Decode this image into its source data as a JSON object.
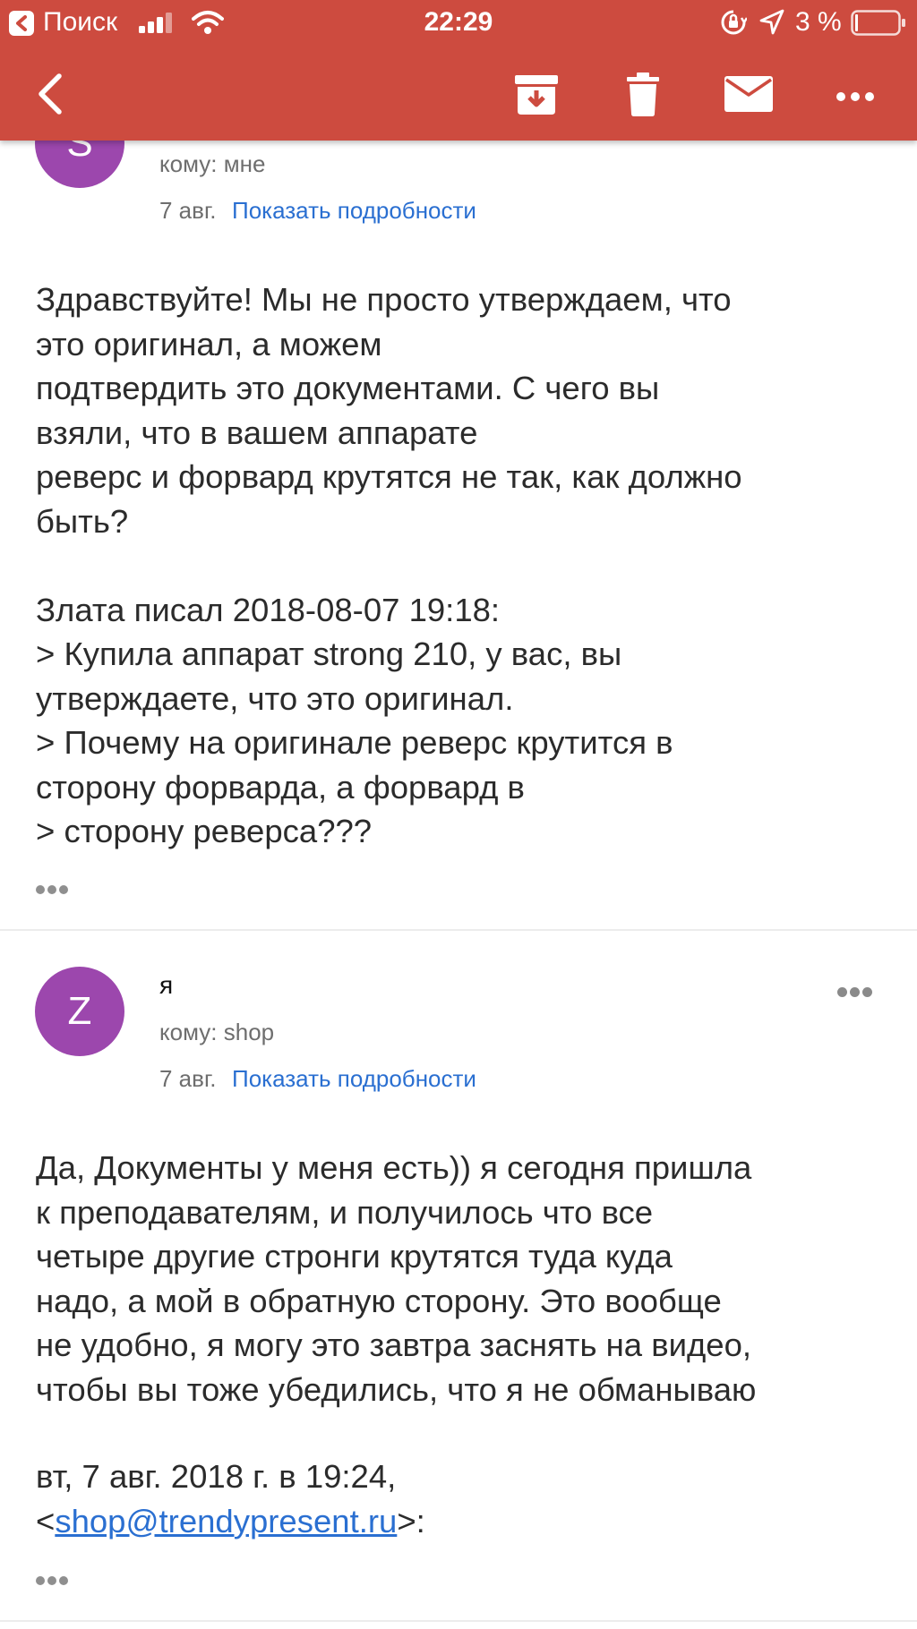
{
  "status_bar": {
    "back_app": "Поиск",
    "time": "22:29",
    "battery": "3 %"
  },
  "toolbar": {
    "back_icon": "chevron-left-icon",
    "archive_icon": "archive-icon",
    "delete_icon": "trash-icon",
    "mail_icon": "envelope-icon",
    "more_icon": "more-horizontal-icon"
  },
  "colors": {
    "header": "#cd4b3f",
    "avatar": "#9c47ad",
    "link": "#2a6fd1"
  },
  "messages": [
    {
      "avatar_letter": "S",
      "to": "кому: мне",
      "date": "7 авг.",
      "details_link": "Показать подробности",
      "body": "Здравствуйте! Мы не просто утверждаем, что\nэто оригинал, а можем\nподтвердить это документами. С чего вы\nвзяли, что в вашем аппарате\nреверс и форвард крутятся не так, как должно\nбыть?\n\nЗлата писал 2018-08-07 19:18:\n> Купила аппарат strong 210, у вас, вы\nутверждаете, что это оригинал.\n> Почему на оригинале реверс крутится в\nсторону форварда, а форвард в\n> сторону реверса???"
    },
    {
      "avatar_letter": "Z",
      "sender": "я",
      "to": "кому: shop",
      "date": "7 авг.",
      "details_link": "Показать подробности",
      "body": "Да, Документы у меня есть)) я сегодня пришла\nк преподавателям, и получилось что все\nчетыре другие стронги крутятся туда куда\nнадо, а мой в обратную сторону. Это вообще\nне удобно, я могу это завтра заснять на видео,\nчтобы вы тоже убедились, что я не обманываю",
      "quote_header": "вт, 7 авг. 2018 г. в 19:24,",
      "quote_open": "<",
      "quote_email": "shop@trendypresent.ru",
      "quote_close": ">:"
    }
  ]
}
